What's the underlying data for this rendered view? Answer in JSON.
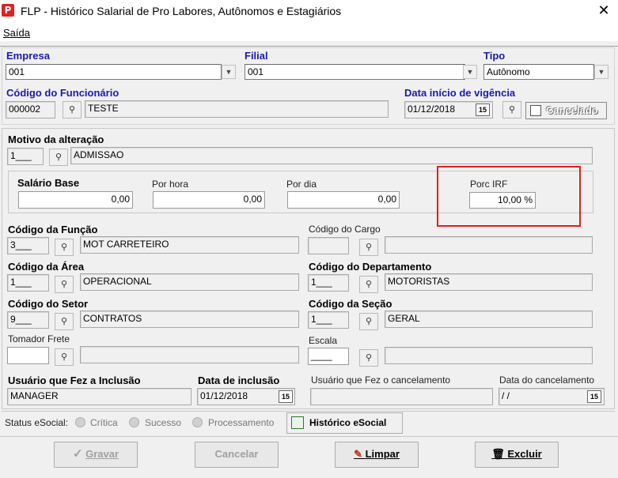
{
  "window": {
    "title": "FLP - Histórico Salarial de Pro Labores, Autônomos e Estagiários",
    "close": "✕"
  },
  "menu": {
    "saida": "Saída"
  },
  "empresa": {
    "label": "Empresa",
    "value": "001"
  },
  "filial": {
    "label": "Filial",
    "value": "001"
  },
  "tipo": {
    "label": "Tipo",
    "value": "Autônomo"
  },
  "funcionario": {
    "label": "Código do Funcionário",
    "code": "000002",
    "name": "TESTE"
  },
  "vigencia": {
    "label": "Data início de vigência",
    "value": "01/12/2018"
  },
  "cancelado": {
    "label": "Cancelado"
  },
  "motivo": {
    "label": "Motivo da alteração",
    "code": "1___",
    "desc": "ADMISSAO"
  },
  "salario": {
    "label": "Salário Base",
    "value": "0,00"
  },
  "por_hora": {
    "label": "Por hora",
    "value": "0,00"
  },
  "por_dia": {
    "label": "Por dia",
    "value": "0,00"
  },
  "porc_irf": {
    "label": "Porc IRF",
    "value": "10,00 %"
  },
  "funcao": {
    "label": "Código da Função",
    "code": "3___",
    "desc": "MOT CARRETEIRO"
  },
  "cargo": {
    "label": "Código do Cargo",
    "code": "",
    "desc": ""
  },
  "area": {
    "label": "Código da Área",
    "code": "1___",
    "desc": "OPERACIONAL"
  },
  "departamento": {
    "label": "Código do Departamento",
    "code": "1___",
    "desc": "MOTORISTAS"
  },
  "setor": {
    "label": "Código do Setor",
    "code": "9___",
    "desc": "CONTRATOS"
  },
  "secao": {
    "label": "Código da Seção",
    "code": "1___",
    "desc": "GERAL"
  },
  "tomador": {
    "label": "Tomador Frete",
    "code": "",
    "desc": ""
  },
  "escala": {
    "label": "Escala",
    "code": "____",
    "desc": ""
  },
  "usuario_inclusao": {
    "label": "Usuário que Fez a Inclusão",
    "value": "MANAGER"
  },
  "data_inclusao": {
    "label": "Data de inclusão",
    "value": "01/12/2018"
  },
  "usuario_cancel": {
    "label": "Usuário que Fez o cancelamento",
    "value": ""
  },
  "data_cancel": {
    "label": "Data do cancelamento",
    "value": " / /"
  },
  "status": {
    "label": "Status eSocial:",
    "critica": "Crítica",
    "sucesso": "Sucesso",
    "processamento": "Processamento",
    "historico_btn": "Histórico eSocial"
  },
  "buttons": {
    "gravar": "Gravar",
    "cancelar": "Cancelar",
    "limpar": "Limpar",
    "excluir": "Excluir"
  },
  "colors": {
    "accent_label": "#1b1bb0",
    "highlight": "#e0201e"
  }
}
